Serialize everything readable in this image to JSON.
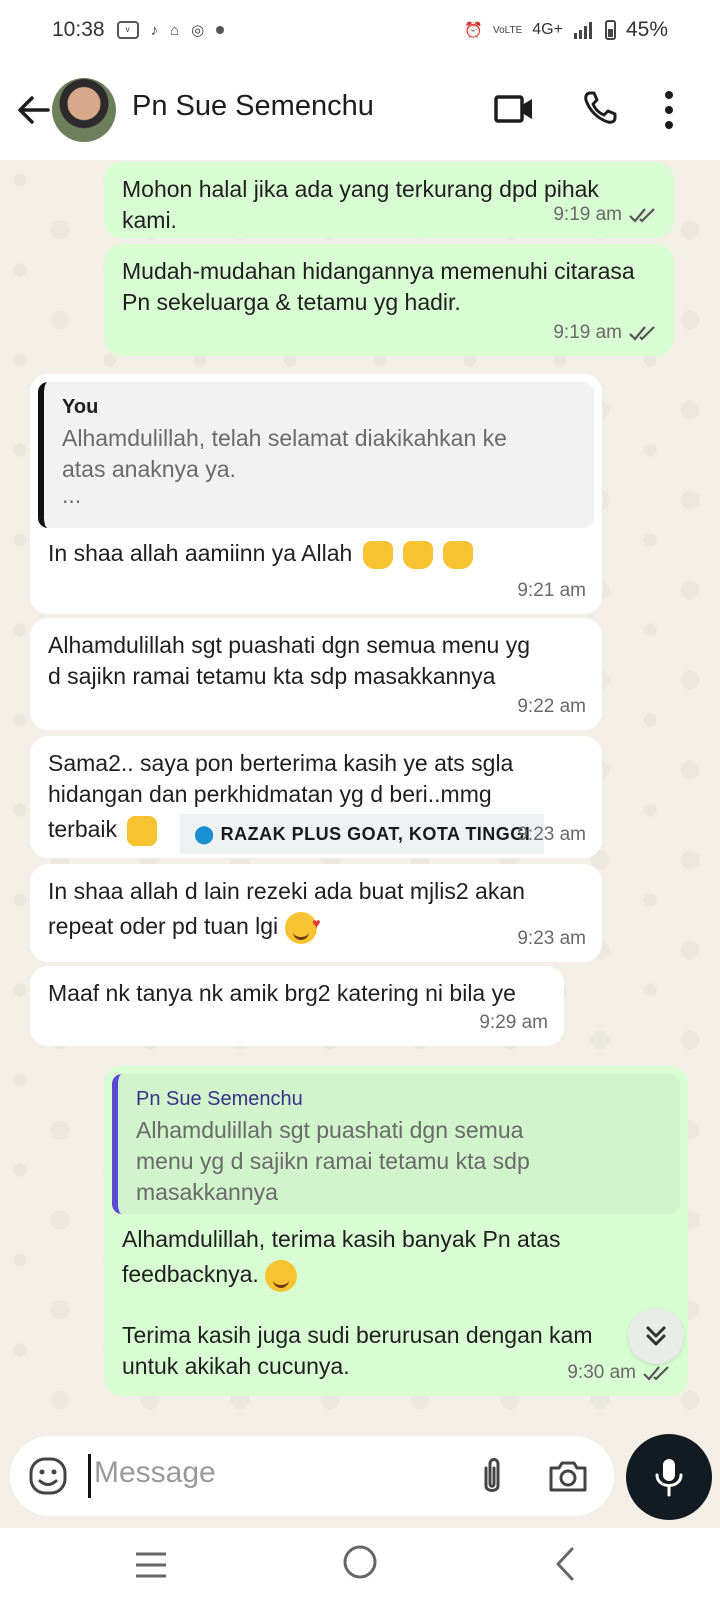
{
  "status_bar": {
    "time": "10:38",
    "network": "4G+",
    "battery": "45%",
    "volte": "VoLTE"
  },
  "header": {
    "contact_name": "Pn Sue Semenchu"
  },
  "messages": [
    {
      "text": "Mohon halal jika ada yang terkurang dpd pihak kami.",
      "time": "9:19 am"
    },
    {
      "text": "Mudah-mudahan hidangannya memenuhi citarasa Pn sekeluarga & tetamu yg hadir.",
      "time": "9:19 am"
    },
    {
      "quote_author": "You",
      "quote_line1": "Alhamdulillah, telah selamat diakikahkan ke",
      "quote_line2": "atas anaknya ya.",
      "quote_line3": "...",
      "text": "In shaa allah aamiinn ya Allah",
      "time": "9:21 am"
    },
    {
      "line1": "Alhamdulillah sgt puashati dgn semua menu yg",
      "line2": "d sajikn ramai tetamu kta sdp masakkannya",
      "time": "9:22 am"
    },
    {
      "line1": "Sama2.. saya pon berterima kasih ye ats sgla",
      "line2": "hidangan dan perkhidmatan yg d beri..mmg",
      "line3": "terbaik",
      "time": "9:23 am"
    },
    {
      "line1": "In shaa allah d lain rezeki ada buat mjlis2 akan",
      "line2": "repeat oder pd tuan lgi",
      "time": "9:23 am"
    },
    {
      "text": "Maaf nk tanya nk amik brg2 katering ni bila ye",
      "time": "9:29 am"
    },
    {
      "quote_author": "Pn Sue Semenchu",
      "quote_line1": "Alhamdulillah sgt puashati dgn semua",
      "quote_line2": "menu yg d sajikn ramai tetamu kta sdp",
      "quote_line3": "masakkannya",
      "line1": "Alhamdulillah, terima kasih banyak Pn atas",
      "line2": "feedbacknya.",
      "line3": "Terima kasih juga sudi berurusan dengan kam",
      "line4": "untuk akikah cucunya.",
      "time": "9:30 am"
    }
  ],
  "location_tag": "RAZAK PLUS GOAT, KOTA TINGGI",
  "input": {
    "placeholder": "Message"
  },
  "colors": {
    "outgoing_bubble": "#d9fdd3",
    "incoming_bubble": "#ffffff",
    "chat_background": "#f3efe7",
    "quote_bar_accent": "#5b4ad1",
    "mic_button": "#111b21"
  },
  "icons": [
    "back-arrow-icon",
    "video-call-icon",
    "phone-icon",
    "more-vertical-icon",
    "double-check-icon",
    "emoji-icon",
    "attach-icon",
    "camera-icon",
    "mic-icon",
    "scroll-down-icon",
    "nav-recents-icon",
    "nav-home-icon",
    "nav-back-icon"
  ]
}
